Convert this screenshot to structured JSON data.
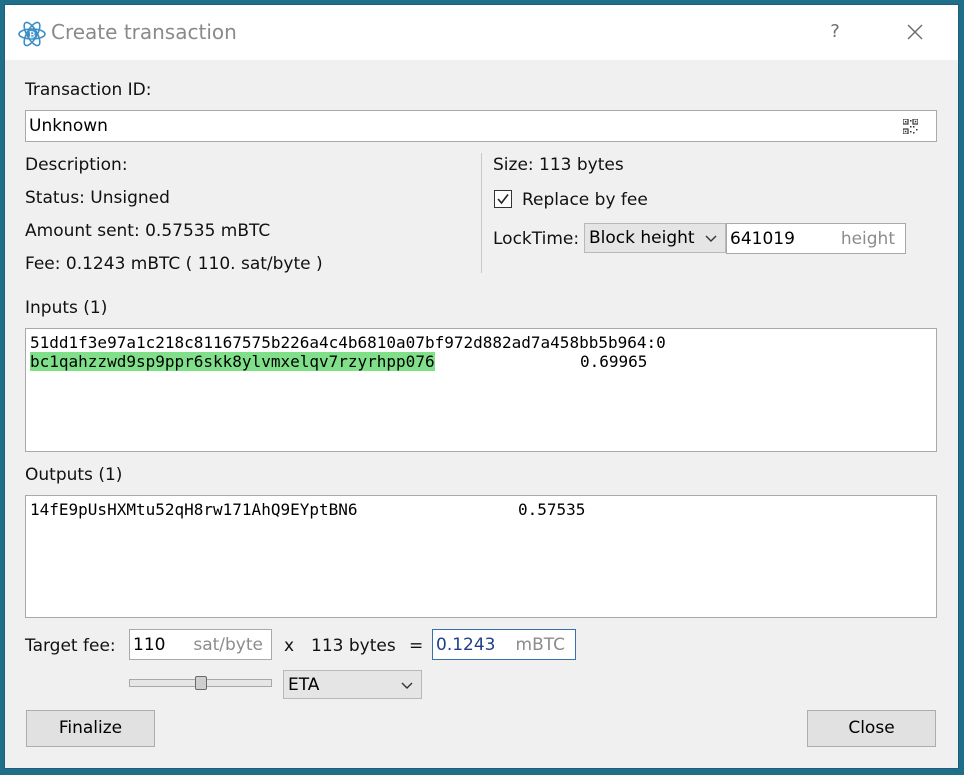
{
  "window": {
    "title": "Create transaction",
    "help_label": "?"
  },
  "txid": {
    "label": "Transaction ID:",
    "value": "Unknown"
  },
  "details": {
    "description_label": "Description:",
    "status": "Status: Unsigned",
    "amount_sent": "Amount sent: 0.57535 mBTC",
    "fee": "Fee: 0.1243 mBTC  ( 110. sat/byte )"
  },
  "right_panel": {
    "size": "Size: 113 bytes",
    "replace_by_fee_label": "Replace by fee",
    "replace_by_fee_checked": true,
    "locktime_label": "LockTime:",
    "locktime_type": "Block height",
    "locktime_value": "641019",
    "locktime_unit": "height"
  },
  "inputs": {
    "label": "Inputs (1)",
    "prevout": "51dd1f3e97a1c218c81167575b226a4c4b6810a07bf972d882ad7a458bb5b964:0",
    "address": "bc1qahzzwd9sp9ppr6skk8ylvmxelqv7rzyrhpp076",
    "amount": "0.69965"
  },
  "outputs": {
    "label": "Outputs (1)",
    "address": "14fE9pUsHXMtu52qH8rw171AhQ9EYptBN6",
    "amount": "0.57535"
  },
  "fee_row": {
    "label": "Target fee:",
    "fee_rate_value": "110",
    "fee_rate_unit": "sat/byte",
    "times": "x",
    "size": "113 bytes",
    "equals": "=",
    "fee_value": "0.1243",
    "fee_unit": "mBTC",
    "mode": "ETA",
    "slider_fraction": 0.5
  },
  "buttons": {
    "finalize": "Finalize",
    "close": "Close"
  },
  "colors": {
    "accent": "#1f6f8b",
    "address_highlight": "#80e08a",
    "fee_value_text": "#1d3f8c"
  }
}
